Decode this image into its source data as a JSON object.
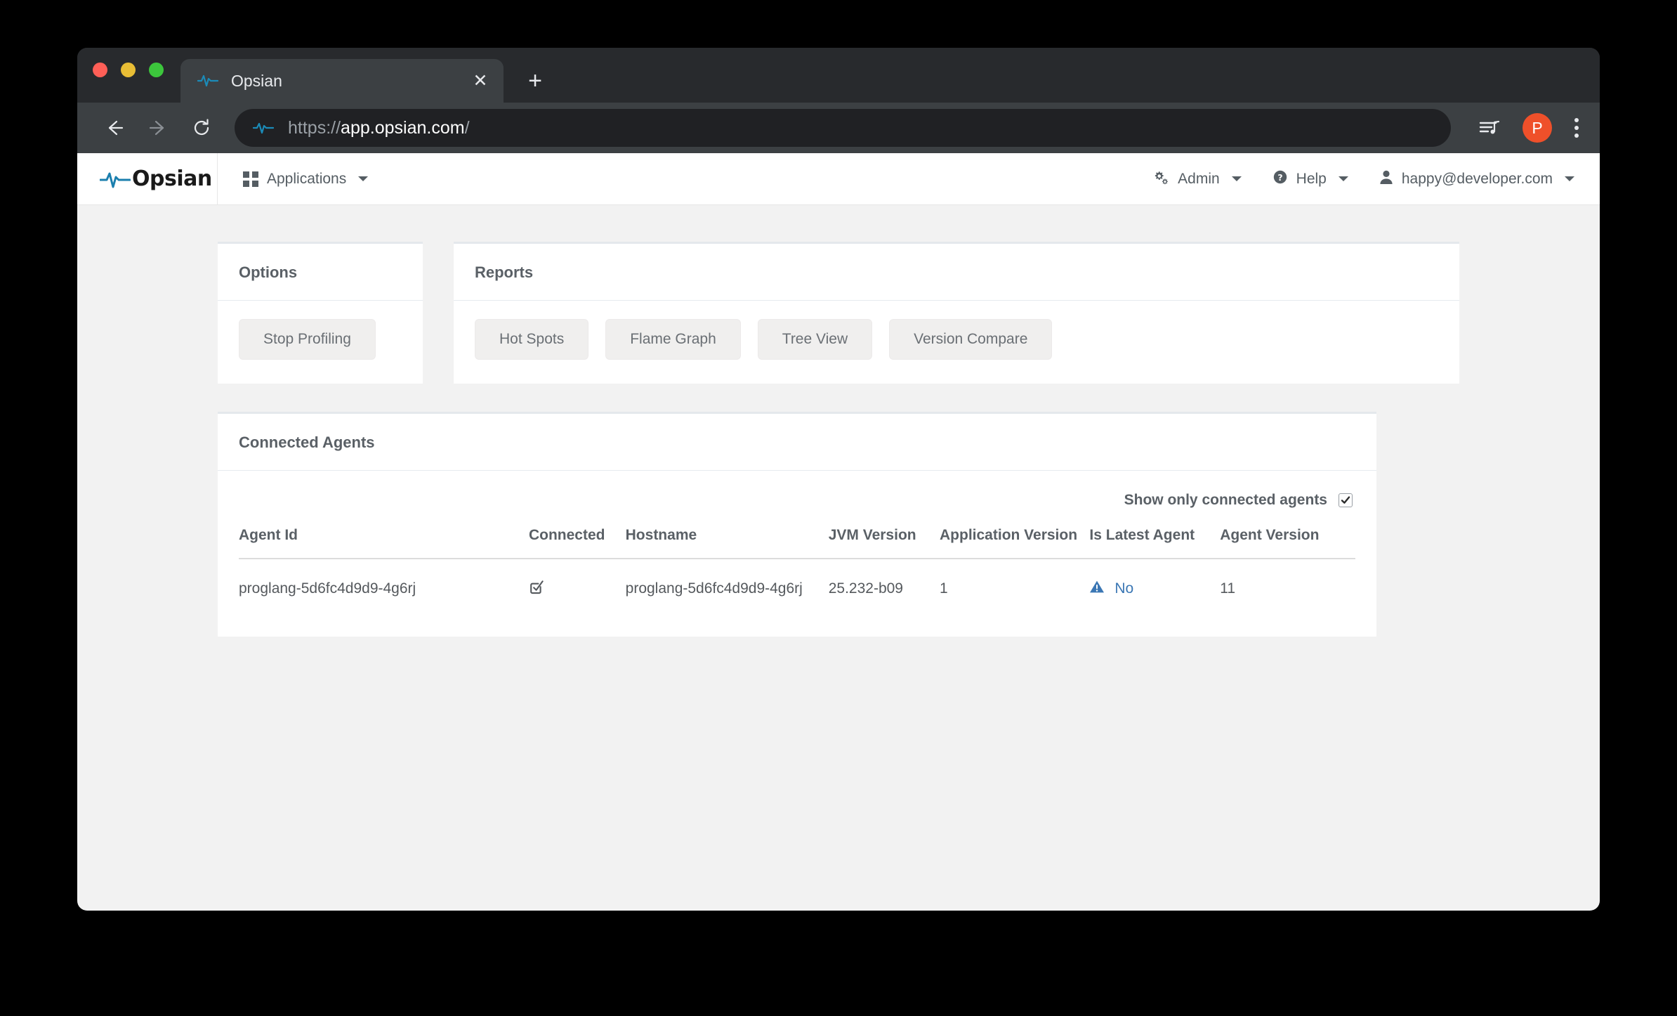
{
  "browser": {
    "tab": {
      "title": "Opsian",
      "favicon_icon": "pulse-waveform-icon",
      "close_icon": "close-icon"
    },
    "new_tab_icon": "plus-icon",
    "back_icon": "arrow-left-icon",
    "forward_icon": "arrow-right-icon",
    "reload_icon": "reload-icon",
    "url": {
      "scheme": "https://",
      "host": "app.opsian.com",
      "path": "/",
      "favicon_icon": "pulse-waveform-icon"
    },
    "media_icon": "media-playlist-icon",
    "profile": {
      "initial": "P",
      "color": "#ef502a"
    },
    "menu_icon": "kebab-menu-icon"
  },
  "app": {
    "brand": {
      "text": "Opsian",
      "icon": "pulse-waveform-icon"
    },
    "nav_left": [
      {
        "label": "Applications",
        "icon": "grid-icon",
        "caret": true
      }
    ],
    "nav_right": [
      {
        "label": "Admin",
        "icon": "cogs-icon",
        "caret": true
      },
      {
        "label": "Help",
        "icon": "question-circle-icon",
        "caret": true
      },
      {
        "label": "happy@developer.com",
        "icon": "user-icon",
        "caret": true
      }
    ]
  },
  "options_panel": {
    "title": "Options",
    "buttons": [
      {
        "label": "Stop Profiling"
      }
    ]
  },
  "reports_panel": {
    "title": "Reports",
    "buttons": [
      {
        "label": "Hot Spots"
      },
      {
        "label": "Flame Graph"
      },
      {
        "label": "Tree View"
      },
      {
        "label": "Version Compare"
      }
    ]
  },
  "agents_panel": {
    "title": "Connected Agents",
    "filter": {
      "label": "Show only connected agents",
      "checked": true
    },
    "columns": [
      "Agent Id",
      "Connected",
      "Hostname",
      "JVM Version",
      "Application Version",
      "Is Latest Agent",
      "Agent Version"
    ],
    "rows": [
      {
        "agent_id": "proglang-5d6fc4d9d9-4g6rj",
        "connected": true,
        "connected_icon": "check-square-icon",
        "hostname": "proglang-5d6fc4d9d9-4g6rj",
        "jvm_version": "25.232-b09",
        "application_version": "1",
        "is_latest_agent": "No",
        "is_latest_icon": "warning-triangle-icon",
        "agent_version": "11"
      }
    ]
  },
  "colors": {
    "accent_blue": "#3b77b4",
    "brand_wave": "#1b7fae",
    "page_bg": "#f2f2f2",
    "panel_top_border": "#e4e8ec",
    "text_muted": "#5a6066"
  }
}
